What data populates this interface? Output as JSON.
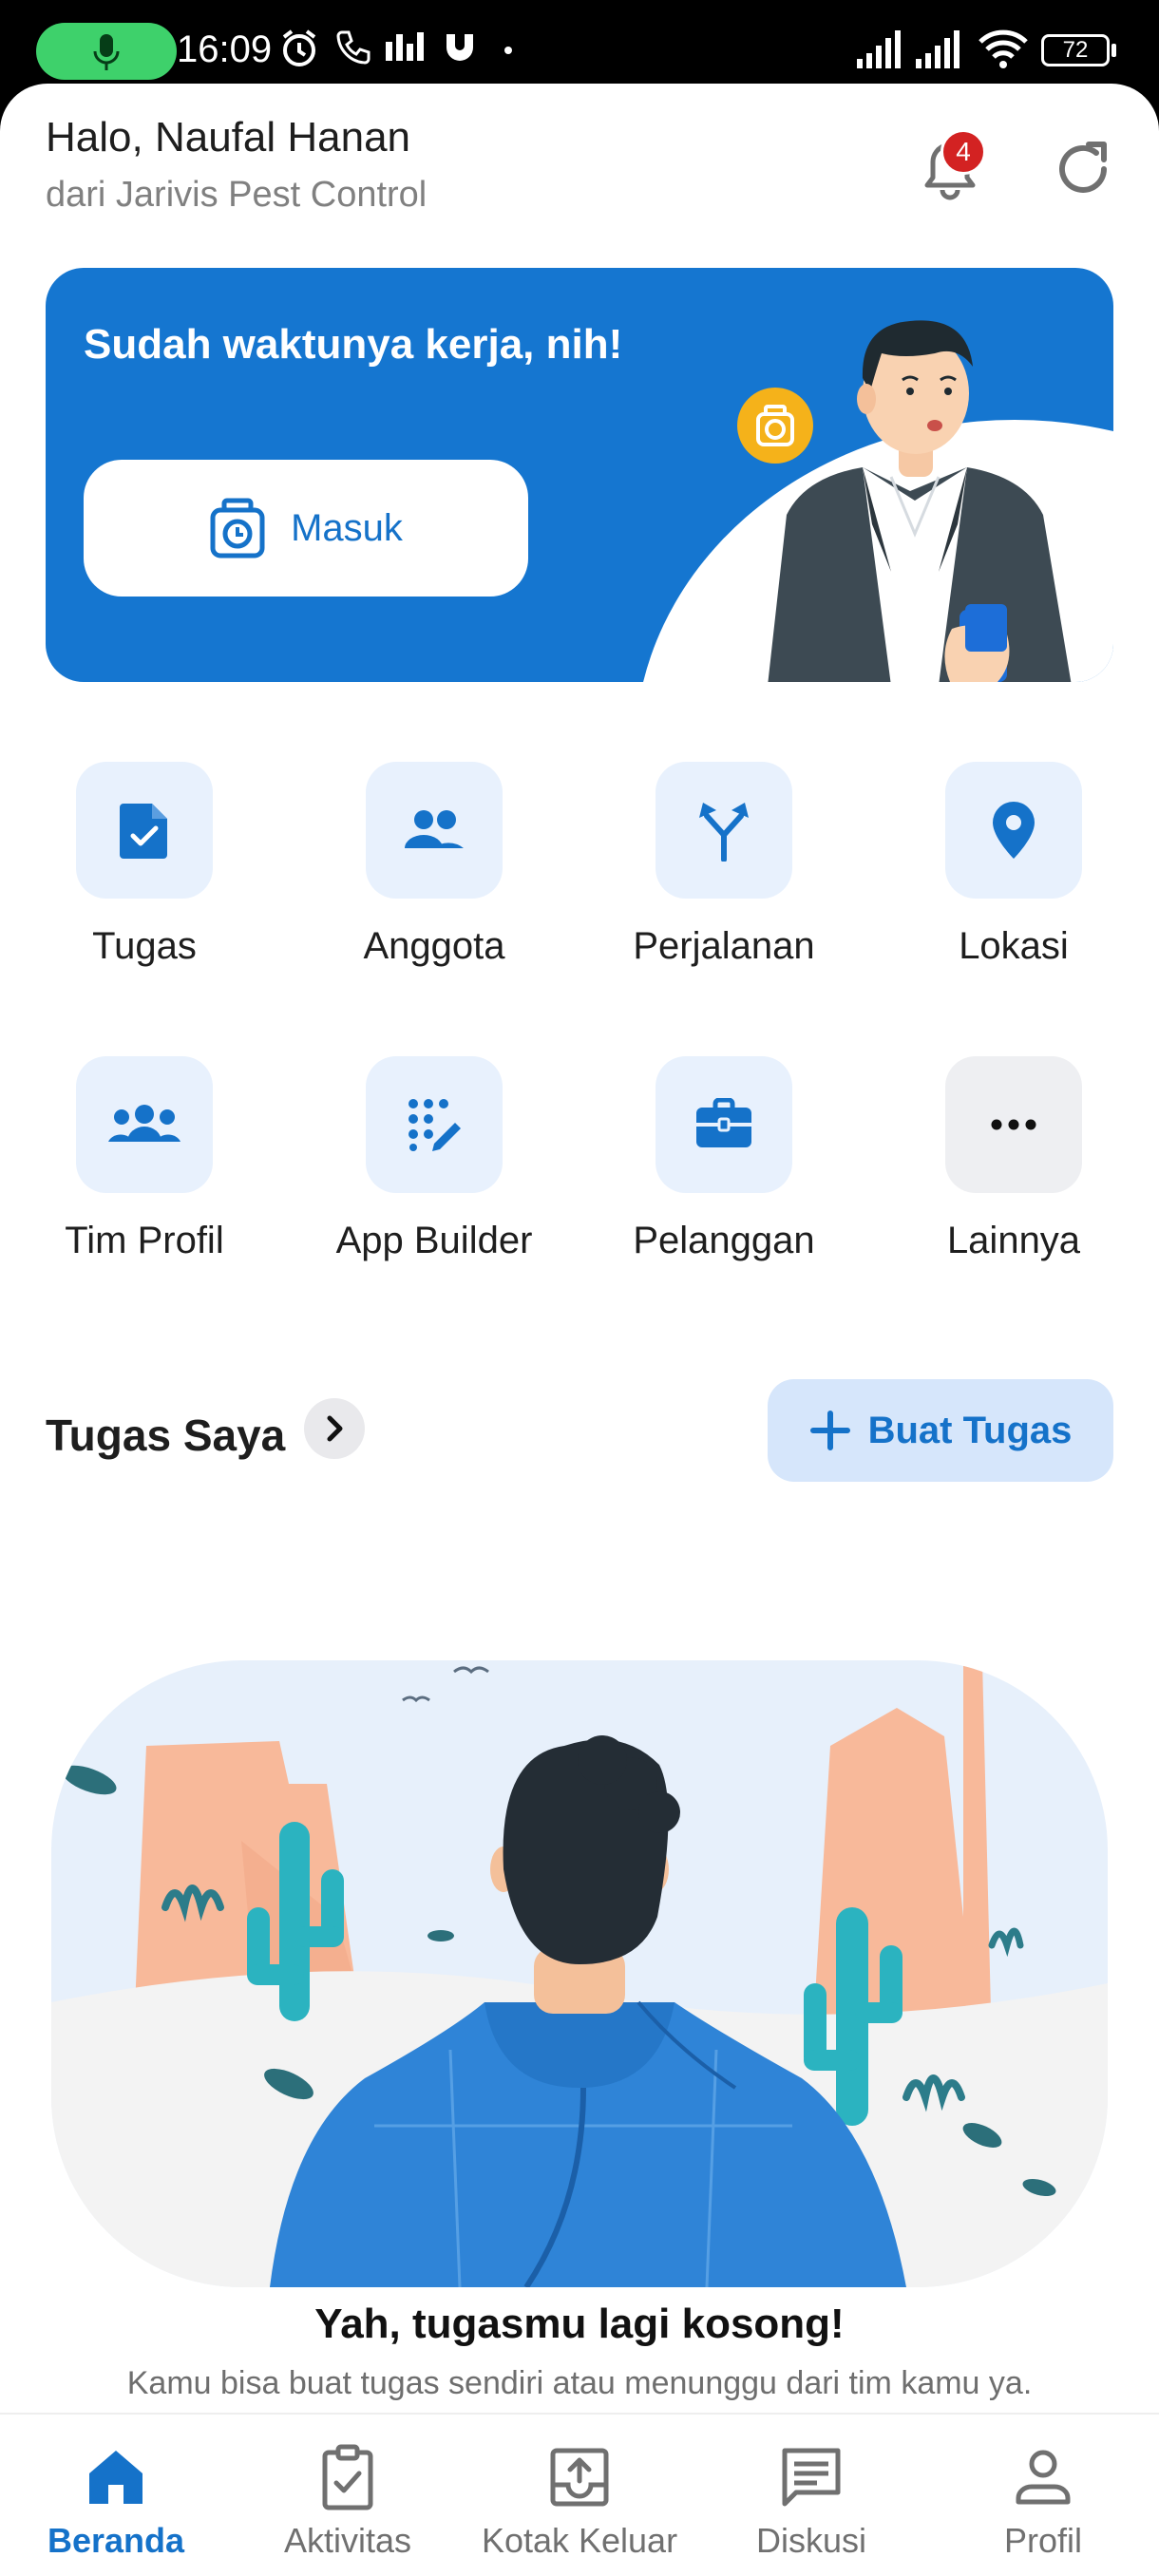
{
  "status_bar": {
    "time": "16:09",
    "battery": "72",
    "icons": [
      "mic-icon",
      "alarm-icon",
      "phone-icon",
      "equalizer-icon",
      "app-icon",
      "signal-icon",
      "wifi-icon",
      "battery-icon"
    ]
  },
  "header": {
    "greeting": "Halo, Naufal Hanan",
    "company": "dari Jarivis Pest Control",
    "notification_count": "4"
  },
  "hero": {
    "title": "Sudah waktunya kerja, nih!",
    "checkin_label": "Masuk"
  },
  "menu": {
    "items": [
      {
        "label": "Tugas",
        "icon": "task-doc-icon"
      },
      {
        "label": "Anggota",
        "icon": "members-icon"
      },
      {
        "label": "Perjalanan",
        "icon": "route-split-icon"
      },
      {
        "label": "Lokasi",
        "icon": "location-pin-icon"
      },
      {
        "label": "Tim Profil",
        "icon": "team-icon"
      },
      {
        "label": "App Builder",
        "icon": "app-builder-icon"
      },
      {
        "label": "Pelanggan",
        "icon": "briefcase-icon"
      },
      {
        "label": "Lainnya",
        "icon": "more-icon"
      }
    ]
  },
  "my_tasks": {
    "title": "Tugas Saya",
    "create_label": "Buat Tugas",
    "empty_title": "Yah, tugasmu lagi kosong!",
    "empty_subtitle": "Kamu bisa buat tugas sendiri atau menunggu dari tim kamu ya."
  },
  "bottom_nav": {
    "items": [
      {
        "label": "Beranda",
        "icon": "home-icon",
        "active": true
      },
      {
        "label": "Aktivitas",
        "icon": "activity-icon",
        "active": false
      },
      {
        "label": "Kotak Keluar",
        "icon": "outbox-icon",
        "active": false
      },
      {
        "label": "Diskusi",
        "icon": "chat-icon",
        "active": false
      },
      {
        "label": "Profil",
        "icon": "profile-icon",
        "active": false
      }
    ]
  },
  "colors": {
    "primary": "#1576d0",
    "tile_bg": "#e8f1fd",
    "badge": "#d32222",
    "mic_pill": "#3ed16b"
  }
}
